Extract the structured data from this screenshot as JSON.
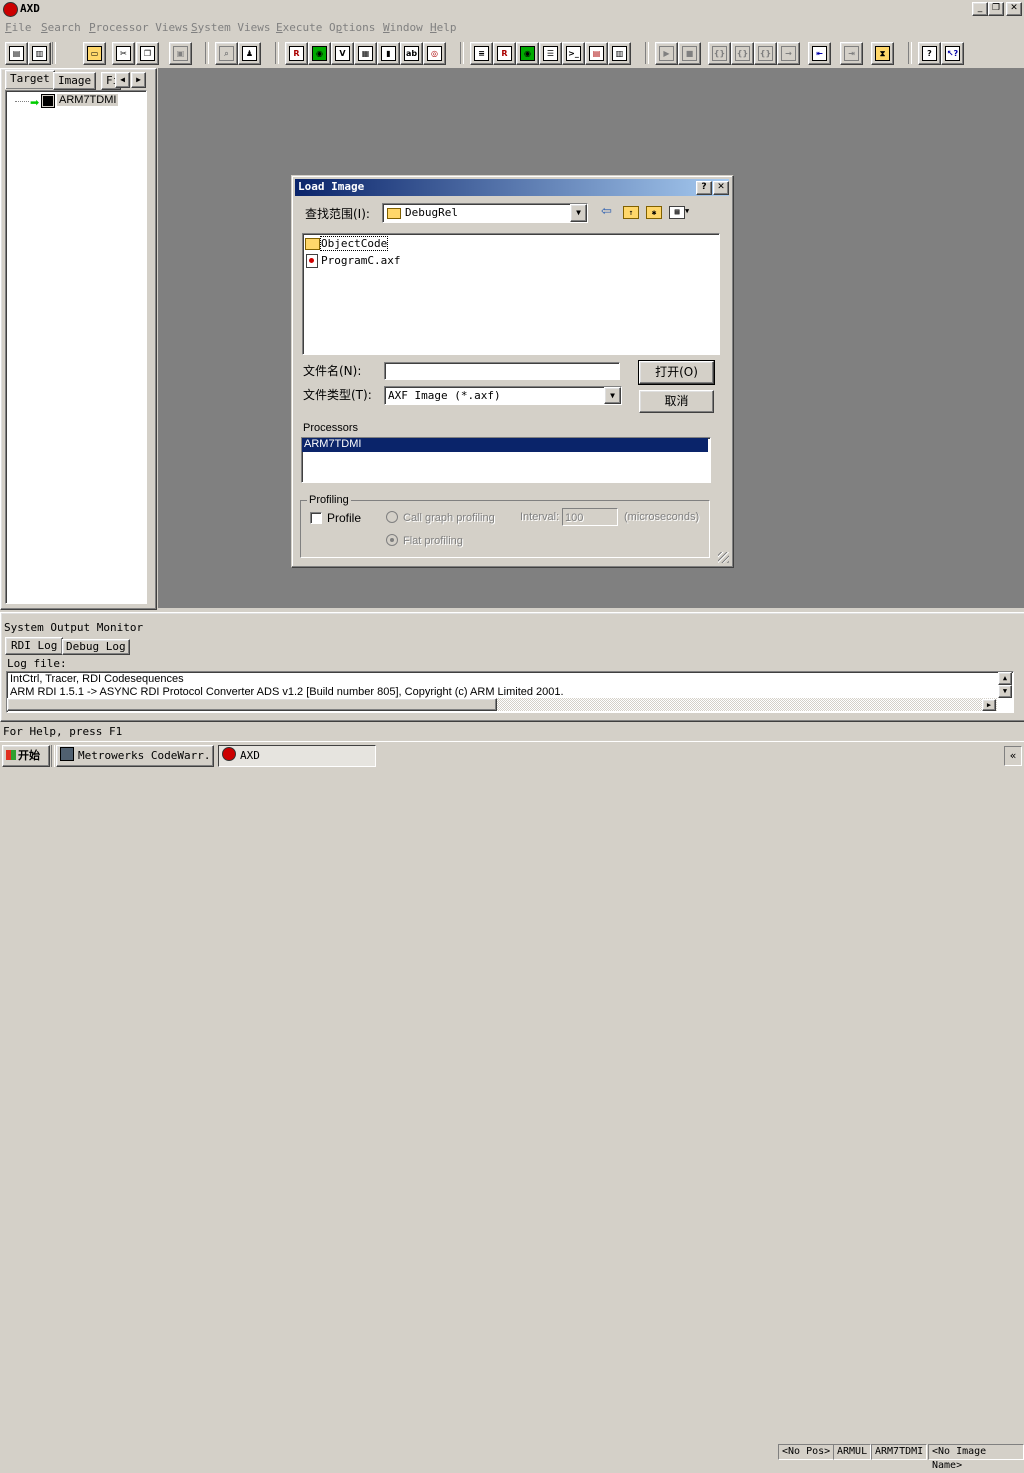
{
  "app": {
    "title": "AXD"
  },
  "menu": [
    {
      "key": "F",
      "rest": "ile"
    },
    {
      "key": "S",
      "rest": "earch"
    },
    {
      "key": "P",
      "rest": "rocessor Views"
    },
    {
      "key": "S",
      "rest": "ystem Views"
    },
    {
      "key": "E",
      "rest": "xecute"
    },
    {
      "pre": "O",
      "key": "p",
      "rest": "tions"
    },
    {
      "key": "W",
      "rest": "indow"
    },
    {
      "key": "H",
      "rest": "elp"
    }
  ],
  "left_panel": {
    "tabs": [
      "Target",
      "Image",
      "Fi"
    ],
    "tree_item": "ARM7TDMI"
  },
  "dialog": {
    "title": "Load Image",
    "look_in_label": "查找范围(I):",
    "look_in_value": "DebugRel",
    "files": [
      "ObjectCode",
      "ProgramC.axf"
    ],
    "filename_label": "文件名(N):",
    "filename_value": "",
    "filetype_label": "文件类型(T):",
    "filetype_value": "AXF Image (*.axf)",
    "open_button": "打开(O)",
    "cancel_button": "取消",
    "processors_label": "Processors",
    "processors": [
      "ARM7TDMI"
    ],
    "profiling": {
      "group_label": "Profiling",
      "profile_label": "Profile",
      "call_graph_label": "Call graph profiling",
      "interval_label": "Interval:",
      "interval_value": "100",
      "units_label": "(microseconds)",
      "flat_label": "Flat profiling"
    }
  },
  "monitor": {
    "title": "System Output Monitor",
    "tabs": [
      "RDI Log",
      "Debug Log"
    ],
    "log_label": "Log file:",
    "log_lines": [
      "IntCtrl, Tracer, RDI Codesequences",
      "ARM RDI 1.5.1 -> ASYNC RDI Protocol Converter ADS v1.2 [Build number 805], Copyright (c) ARM Limited 2001."
    ]
  },
  "status": {
    "help_text": "For Help, press F1",
    "panes": [
      "<No Pos>",
      "ARMUL",
      "ARM7TDMI",
      "<No Image Name>"
    ]
  },
  "taskbar": {
    "start": "开始",
    "tasks": [
      "Metrowerks CodeWarr...",
      "AXD"
    ]
  },
  "colors": {
    "dialog_title": "#0a246a",
    "selection": "#0a246a",
    "mdi_bg": "#808080",
    "chrome": "#d4d0c8"
  }
}
